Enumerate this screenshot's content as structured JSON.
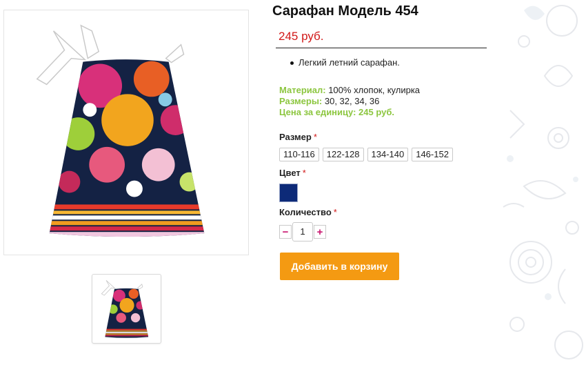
{
  "product": {
    "title": "Сарафан Модель 454",
    "price": "245 руб.",
    "description": [
      "Легкий летний сарафан."
    ],
    "specs": {
      "material_label": "Материал:",
      "material_value": "100% хлопок, кулирка",
      "sizes_label": "Размеры:",
      "sizes_value": "30, 32, 34, 36",
      "unit_price_label": "Цена за единицу:",
      "unit_price_value": "245 руб."
    }
  },
  "options": {
    "size_label": "Размер",
    "sizes": [
      "110-116",
      "122-128",
      "134-140",
      "146-152"
    ],
    "color_label": "Цвет",
    "color_swatch": "#0d2a78",
    "quantity_label": "Количество",
    "quantity_value": "1",
    "required_mark": "*",
    "minus": "−",
    "plus": "+"
  },
  "cart": {
    "add_label": "Добавить в корзину"
  },
  "colors": {
    "accent_orange": "#f49a12",
    "price_red": "#d11818",
    "spec_green": "#8cc63f",
    "qty_magenta": "#c8146e"
  }
}
